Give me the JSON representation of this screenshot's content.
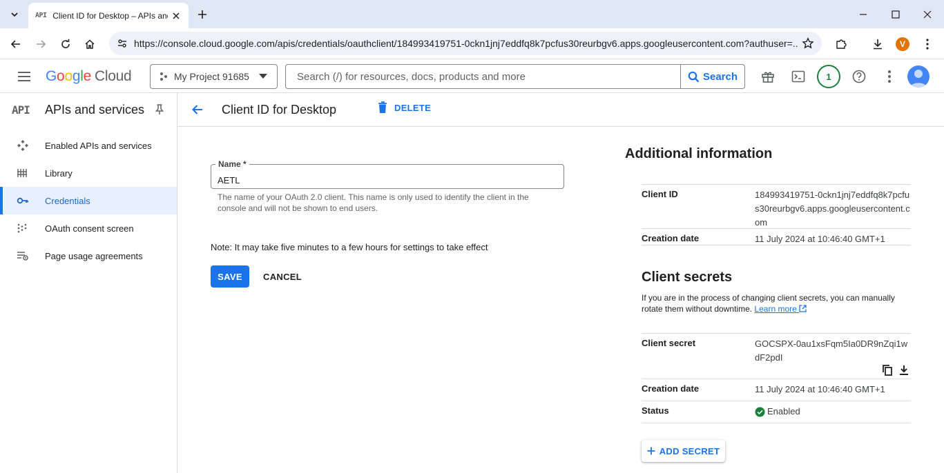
{
  "browser": {
    "tab_favicon": "API",
    "tab_title": "Client ID for Desktop – APIs and services",
    "url": "https://console.cloud.google.com/apis/credentials/oauthclient/184993419751-0ckn1jnj7eddfq8k7pcfus30reurbgv6.apps.googleusercontent.com?authuser=...",
    "profile_initial": "V"
  },
  "header": {
    "logo_g": [
      "G",
      "o",
      "o",
      "g",
      "l",
      "e"
    ],
    "logo_cloud": "Cloud",
    "project_name": "My Project 91685",
    "search_placeholder": "Search (/) for resources, docs, products and more",
    "search_button": "Search",
    "notification_count": "1"
  },
  "sidebar": {
    "badge": "API",
    "title": "APIs and services",
    "items": [
      {
        "label": "Enabled APIs and services",
        "icon": "enabled-apis-icon"
      },
      {
        "label": "Library",
        "icon": "library-icon"
      },
      {
        "label": "Credentials",
        "icon": "key-icon",
        "active": true
      },
      {
        "label": "OAuth consent screen",
        "icon": "consent-icon"
      },
      {
        "label": "Page usage agreements",
        "icon": "agreements-icon"
      }
    ]
  },
  "page": {
    "title": "Client ID for Desktop",
    "delete_label": "DELETE"
  },
  "form": {
    "name_label": "Name *",
    "name_value": "AETL",
    "name_hint": "The name of your OAuth 2.0 client. This name is only used to identify the client in the console and will not be shown to end users.",
    "note": "Note: It may take five minutes to a few hours for settings to take effect",
    "save_label": "SAVE",
    "cancel_label": "CANCEL"
  },
  "info": {
    "title": "Additional information",
    "client_id_label": "Client ID",
    "client_id_value": "184993419751-0ckn1jnj7eddfq8k7pcfus30reurbgv6.apps.googleusercontent.com",
    "creation_label": "Creation date",
    "creation_value": "11 July 2024 at 10:46:40 GMT+1"
  },
  "secrets": {
    "title": "Client secrets",
    "description": "If you are in the process of changing client secrets, you can manually rotate them without downtime.",
    "learn_more": "Learn more",
    "secret_label": "Client secret",
    "secret_value": "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",
    "creation_label": "Creation date",
    "creation_value": "11 July 2024 at 10:46:40 GMT+1",
    "status_label": "Status",
    "status_value": "Enabled",
    "add_secret_label": "ADD SECRET"
  },
  "colors": {
    "accent": "#1a73e8",
    "active_bg": "#e8f0fe",
    "enabled_green": "#188038"
  }
}
